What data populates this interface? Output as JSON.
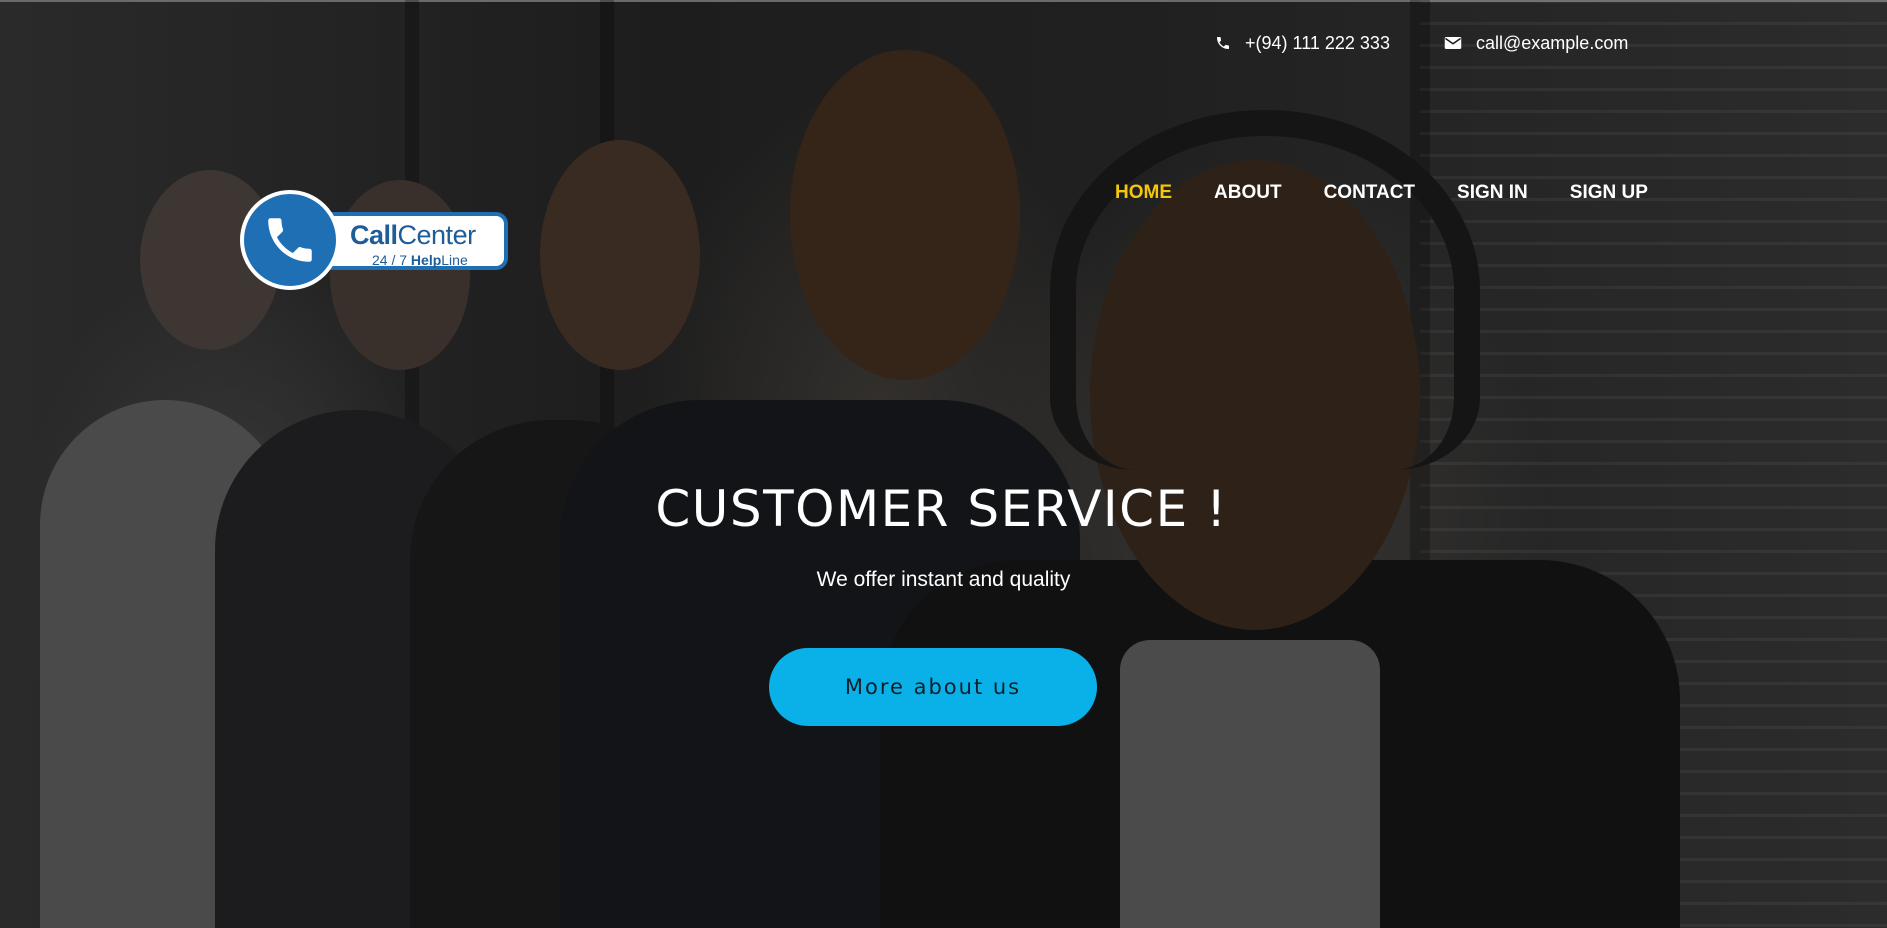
{
  "contact": {
    "phone": "+(94) 111 222 333",
    "email": "call@example.com",
    "phone_icon": "phone-icon",
    "email_icon": "envelope-icon"
  },
  "logo": {
    "title_bold": "Call",
    "title_rest": "Center",
    "sub_plain": "24 / 7 ",
    "sub_bold": "Help",
    "sub_rest": "Line",
    "brand_color": "#1f6fb5"
  },
  "nav": {
    "items": [
      {
        "label": "HOME",
        "active": true
      },
      {
        "label": "ABOUT",
        "active": false
      },
      {
        "label": "CONTACT",
        "active": false
      },
      {
        "label": "SIGN IN",
        "active": false
      },
      {
        "label": "SIGN UP",
        "active": false
      }
    ],
    "active_color": "#f4c60d"
  },
  "hero": {
    "title": "CUSTOMER SERVICE !",
    "subtitle": "We offer instant and quality",
    "cta_label": "More about us",
    "cta_color": "#0ab1e8"
  }
}
